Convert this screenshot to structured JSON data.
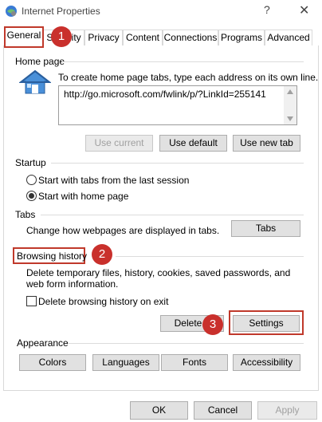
{
  "window": {
    "title": "Internet Properties",
    "help_glyph": "?",
    "close_glyph": "✕"
  },
  "tabs": [
    {
      "label": "General",
      "selected": true
    },
    {
      "label": "Security",
      "selected": false
    },
    {
      "label": "Privacy",
      "selected": false
    },
    {
      "label": "Content",
      "selected": false
    },
    {
      "label": "Connections",
      "selected": false
    },
    {
      "label": "Programs",
      "selected": false
    },
    {
      "label": "Advanced",
      "selected": false
    }
  ],
  "home_page": {
    "title": "Home page",
    "description": "To create home page tabs, type each address on its own line.",
    "url": "http://go.microsoft.com/fwlink/p/?LinkId=255141",
    "buttons": {
      "use_current": "Use current",
      "use_default": "Use default",
      "use_new_tab": "Use new tab"
    }
  },
  "startup": {
    "title": "Startup",
    "options": [
      {
        "label": "Start with tabs from the last session",
        "checked": false
      },
      {
        "label": "Start with home page",
        "checked": true
      }
    ]
  },
  "tabs_section": {
    "title": "Tabs",
    "description": "Change how webpages are displayed in tabs.",
    "button": "Tabs"
  },
  "browsing_history": {
    "title": "Browsing history",
    "description": "Delete temporary files, history, cookies, saved passwords, and web form information.",
    "checkbox_label": "Delete browsing history on exit",
    "checkbox_checked": false,
    "delete_button": "Delete...",
    "settings_button": "Settings"
  },
  "appearance": {
    "title": "Appearance",
    "buttons": [
      "Colors",
      "Languages",
      "Fonts",
      "Accessibility"
    ]
  },
  "footer": {
    "ok": "OK",
    "cancel": "Cancel",
    "apply": "Apply"
  },
  "annotations": {
    "badge_1": "1",
    "badge_2": "2",
    "badge_3": "3",
    "color": "#c9302c"
  }
}
